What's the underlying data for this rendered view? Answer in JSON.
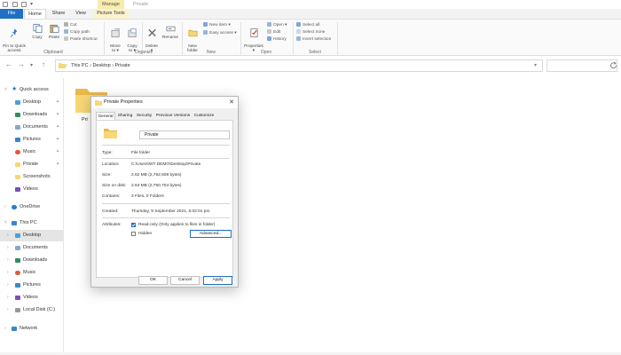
{
  "ribbon": {
    "manage_tab": "Manage",
    "window_title": "Private",
    "tabs": [
      "File",
      "Home",
      "Share",
      "View",
      "Picture Tools"
    ],
    "clipboard": {
      "pin_label": "Pin to Quick\naccess",
      "copy_label": "Copy",
      "paste_label": "Paste",
      "cut_label": "Cut",
      "copy_path_label": "Copy path",
      "paste_shortcut_label": "Paste shortcut",
      "group_label": "Clipboard"
    },
    "organize": {
      "move_to_label": "Move\nto ▾",
      "copy_to_label": "Copy\nto ▾",
      "delete_label": "Delete\n▾",
      "rename_label": "Rename",
      "group_label": "Organize"
    },
    "new": {
      "new_folder_label": "New\nfolder",
      "new_item_label": "New item ▾",
      "easy_access_label": "Easy access ▾",
      "group_label": "New"
    },
    "open": {
      "properties_label": "Properties\n▾",
      "open_label": "Open ▾",
      "edit_label": "Edit",
      "history_label": "History",
      "group_label": "Open"
    },
    "select": {
      "select_all_label": "Select all",
      "select_none_label": "Select none",
      "invert_label": "Invert selection",
      "group_label": "Select"
    }
  },
  "address": {
    "segments": "This PC  ›  Desktop  ›  Private"
  },
  "navpane": {
    "items": [
      {
        "label": "Quick access"
      },
      {
        "label": "Desktop"
      },
      {
        "label": "Downloads"
      },
      {
        "label": "Documents"
      },
      {
        "label": "Pictures"
      },
      {
        "label": "Music"
      },
      {
        "label": "Private"
      },
      {
        "label": "Screenshots"
      },
      {
        "label": "Videos"
      },
      {
        "label": "OneDrive"
      },
      {
        "label": "This PC"
      },
      {
        "label": "Desktop"
      },
      {
        "label": "Documents"
      },
      {
        "label": "Downloads"
      },
      {
        "label": "Music"
      },
      {
        "label": "Pictures"
      },
      {
        "label": "Videos"
      },
      {
        "label": "Local Disk (C:)"
      },
      {
        "label": "Network"
      }
    ]
  },
  "content": {
    "folder_label_partial": "Pri"
  },
  "dialog": {
    "title": "Private Properties",
    "tabs": [
      "General",
      "Sharing",
      "Security",
      "Previous Versions",
      "Customize"
    ],
    "name_value": "Private",
    "type_label": "Type:",
    "type_value": "File folder",
    "location_label": "Location:",
    "location_value": "C:\\Users\\WT DEMO\\Desktop\\Private",
    "size_label": "Size:",
    "size_value": "2.62 MB (2,752,508 bytes)",
    "size_on_disk_label": "Size on disk:",
    "size_on_disk_value": "2.63 MB (2,760,704 bytes)",
    "contains_label": "Contains:",
    "contains_value": "3 Files, 0 Folders",
    "created_label": "Created:",
    "created_value": "Thursday, 9 September 2021, 5:02:01 pm",
    "attributes_label": "Attributes:",
    "readonly_label": "Read-only (Only applies to files in folder)",
    "readonly_checked": true,
    "hidden_label": "Hidden",
    "hidden_checked": false,
    "advanced_label": "Advanced...",
    "ok_label": "OK",
    "cancel_label": "Cancel",
    "apply_label": "Apply"
  },
  "colors": {
    "accent": "#1f6fc5",
    "folder": "#f8d775",
    "manage_tab": "#f7ecae"
  }
}
